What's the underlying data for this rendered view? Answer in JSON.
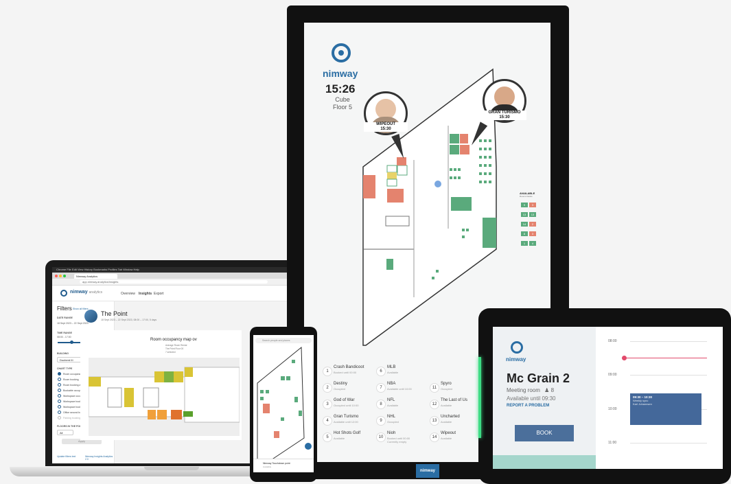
{
  "laptop": {
    "mac_menu": "Chrome  File  Edit  View  History  Bookmarks  Profiles  Tab  Window  Help",
    "tab_title": "Nimway Analytics",
    "url": "app.nimway.analytics/insights",
    "brand": "nimway",
    "brand_suffix": "analytics",
    "nav": [
      "Overview",
      "Insights",
      "Export"
    ],
    "filters_title": "Filters",
    "filters_link": "Show all filters",
    "date_range_label": "DATE RANGE",
    "date_range_value": "18 Sept 2023  –  22 Sept 2023",
    "time_range_label": "TIME RANGE",
    "time_range_value": "08:00 - 17:00",
    "building_label": "BUILDING",
    "building_value": "Docherd III",
    "chart_type_label": "CHART TYPE",
    "chart_types": [
      "Room occupancy",
      "Room booking",
      "Room booking and occupancy",
      "Bookable occupancy",
      "Workspace occupancy",
      "Workspace booking",
      "Workspace booking and occupancy",
      "Office second booking",
      "Parking booking"
    ],
    "floors_label": "FLOORS IN THE POINT",
    "floors_value": "All",
    "apply_label": "Apply",
    "footer_left": "Update filters text",
    "footer_right": "Nimway Insights Analytics 2.0",
    "page_title": "The Point",
    "page_subtitle": "18 Sept 2023 – 22 Sept 2023, 08:00 – 17:00, 5 days",
    "card_title": "Room occupancy map ov",
    "card_lines": [
      "Average Room Rental",
      "The Point Floor 00",
      "7 selected"
    ]
  },
  "kiosk": {
    "brand": "nimway",
    "time": "15:26",
    "building": "Cube",
    "floor": "Floor 5",
    "pins": [
      {
        "name": "WIPEOUT",
        "time": "15:30"
      },
      {
        "name": "GRAN TURISMO",
        "time": "15:30"
      }
    ],
    "legend_title": "AVAILABLE",
    "legend_subtitle": "Rooms  Desks",
    "legend_values": [
      "9",
      "3",
      "13",
      "13",
      "14",
      "2",
      "8",
      "3",
      "1",
      "4"
    ],
    "rooms": [
      {
        "num": "1",
        "name": "Crash Bandicoot",
        "status": "Booked until 00:00"
      },
      {
        "num": "2",
        "name": "Destiny",
        "status": "Occupied"
      },
      {
        "num": "3",
        "name": "God of War",
        "status": "Occupied until 10:00"
      },
      {
        "num": "4",
        "name": "Gran Turismo",
        "status": "Available until 12:00"
      },
      {
        "num": "5",
        "name": "Hot Shots Golf",
        "status": "Available"
      },
      {
        "num": "6",
        "name": "MLB",
        "status": "Available"
      },
      {
        "num": "7",
        "name": "NBA",
        "status": "Available until 10:00"
      },
      {
        "num": "8",
        "name": "NFL",
        "status": "Available"
      },
      {
        "num": "9",
        "name": "NHL",
        "status": "Occupied"
      },
      {
        "num": "10",
        "name": "Nioh",
        "status": "Booked until 00:00"
      },
      {
        "num": "11",
        "name": "Spyro",
        "status": "Occupied"
      },
      {
        "num": "12",
        "name": "The Last of Us",
        "status": "Available"
      },
      {
        "num": "13",
        "name": "Uncharted",
        "status": "Available"
      },
      {
        "num": "14",
        "name": "Wipeout",
        "status": "Available"
      }
    ],
    "nioh_extra": "Currently empty",
    "footer_brand": "nimway"
  },
  "phone": {
    "search_placeholder": "Search people and places",
    "sheet_title": "Nimway Touchdown point",
    "sheet_sub": "Available"
  },
  "tablet": {
    "brand": "nimway",
    "room_name": "Mc Grain 2",
    "room_type": "Meeting room",
    "capacity": "8",
    "availability": "Available until 09:30",
    "report_label": "REPORT A PROBLEM",
    "book_label": "BOOK",
    "times": [
      "08:00",
      "09:00",
      "10:00",
      "11:00"
    ],
    "event_time": "09:30 – 10:30",
    "event_title": "Weekly sync",
    "event_org": "Karl Johannsen"
  },
  "colors": {
    "brand": "#2a6da3",
    "available": "#5aaa7c",
    "occupied": "#e4836e",
    "booked": "#e8d36a",
    "led": "#3ddc84",
    "now_line": "#e24a6b",
    "event": "#44689a"
  }
}
